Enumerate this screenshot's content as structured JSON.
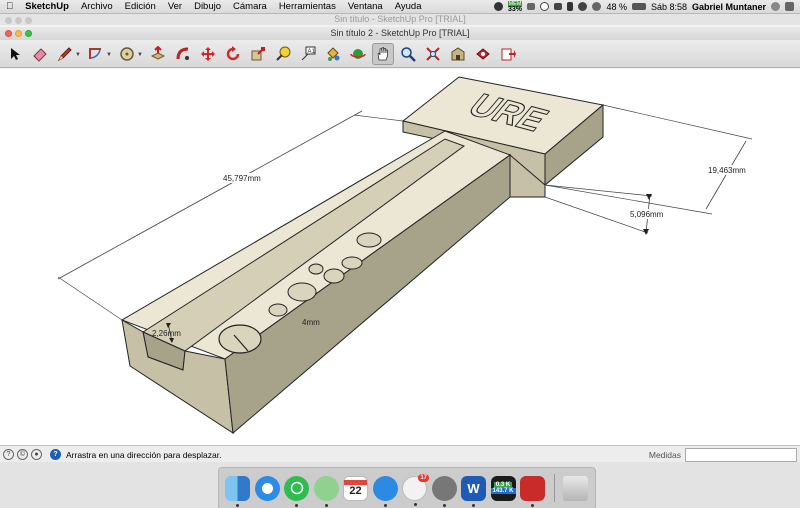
{
  "menubar": {
    "app_name": "SketchUp",
    "items": [
      "Archivo",
      "Edición",
      "Ver",
      "Dibujo",
      "Cámara",
      "Herramientas",
      "Ventana",
      "Ayuda"
    ],
    "battery_percent": "48 %",
    "clock": "Sáb 8:58",
    "user": "Gabriel Muntaner",
    "cpu_label": "MEM",
    "cpu_value": "33%"
  },
  "windows": {
    "background_title": "Sin título - SketchUp Pro [TRIAL]",
    "foreground_title": "Sin título 2 - SketchUp Pro [TRIAL]"
  },
  "toolbar": {
    "tools": [
      "select-tool",
      "eraser-tool",
      "pencil-tool",
      "shapes-tool",
      "push-pull-tool",
      "rotate-tool",
      "move-tool",
      "scale-tool",
      "offset-tool",
      "follow-me-tool",
      "tape-measure-tool",
      "text-tool",
      "paint-bucket-tool",
      "orbit-tool",
      "pan-tool",
      "zoom-tool",
      "zoom-extents-tool",
      "warehouse-tool",
      "extension-warehouse-tool",
      "layout-tool"
    ],
    "active_tool": "pan-tool"
  },
  "model": {
    "engraved_text": "URE",
    "dims": {
      "length": "45,797mm",
      "width": "19,463mm",
      "height": "5,096mm",
      "slot": "2,26mm",
      "hole": "4mm"
    }
  },
  "statusbar": {
    "hint": "Arrastra en una dirección para desplazar.",
    "measure_label": "Medidas",
    "measure_value": ""
  },
  "dock": {
    "calendar_day": "22",
    "badge_count": "17",
    "net_up": "0.3 K",
    "net_down": "143.7 K"
  },
  "colors": {
    "model_face_top": "#ebe7d4",
    "model_face_side": "#c5c0a6",
    "model_face_dark": "#a7a28a",
    "status_hint": "#1f5fb0"
  }
}
